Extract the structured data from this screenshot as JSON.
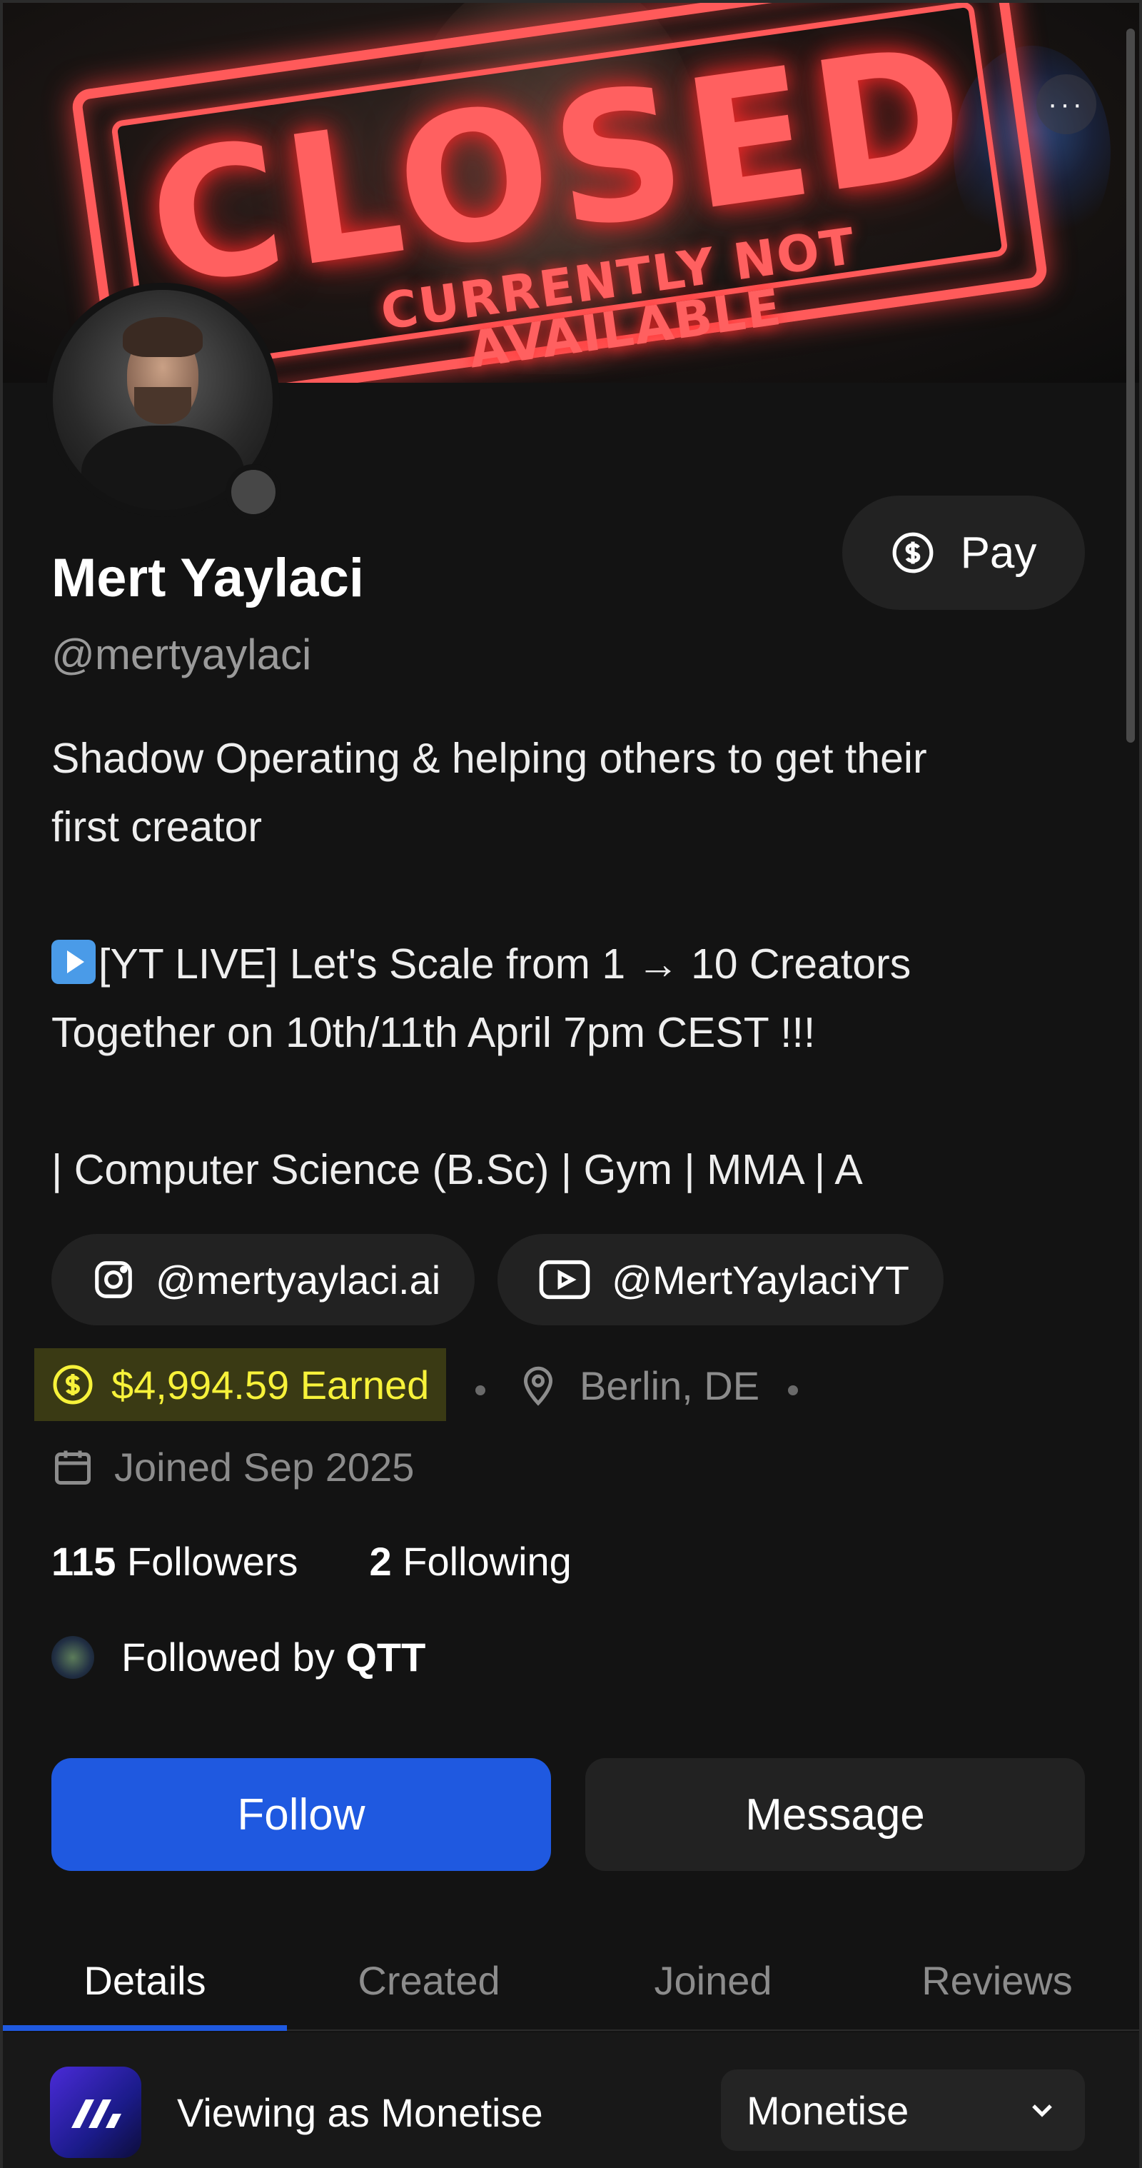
{
  "banner": {
    "stamp_word": "CLOSED",
    "stamp_sub": "CURRENTLY NOT AVAILABLE",
    "more_label": "···"
  },
  "profile": {
    "name": "Mert Yaylaci",
    "handle": "@mertyaylaci",
    "bio": {
      "line1": "Shadow Operating & helping others to get their",
      "line2": "first creator",
      "line3": "[YT LIVE] Let's Scale from 1 → 10 Creators",
      "line4": "Together on 10th/11th April 7pm CEST !!!",
      "line5": "| Computer Science (B.Sc) | Gym | MMA | A"
    }
  },
  "actions": {
    "pay_label": "Pay",
    "follow_label": "Follow",
    "message_label": "Message"
  },
  "social": {
    "instagram": "@mertyaylaci.ai",
    "youtube": "@MertYaylaciYT"
  },
  "meta": {
    "earned": "$4,994.59 Earned",
    "location": "Berlin, DE",
    "joined": "Joined Sep 2025"
  },
  "stats": {
    "followers_count": "115",
    "followers_label": "Followers",
    "following_count": "2",
    "following_label": "Following"
  },
  "followed_by": {
    "prefix": "Followed by",
    "name": "QTT"
  },
  "tabs": [
    {
      "label": "Details"
    },
    {
      "label": "Created"
    },
    {
      "label": "Joined"
    },
    {
      "label": "Reviews"
    }
  ],
  "viewing_as": {
    "label": "Viewing as Monetise",
    "selected": "Monetise"
  },
  "colors": {
    "accent": "#1f59e0",
    "earned": "#f7f23a",
    "stamp": "#ff5a5a"
  }
}
